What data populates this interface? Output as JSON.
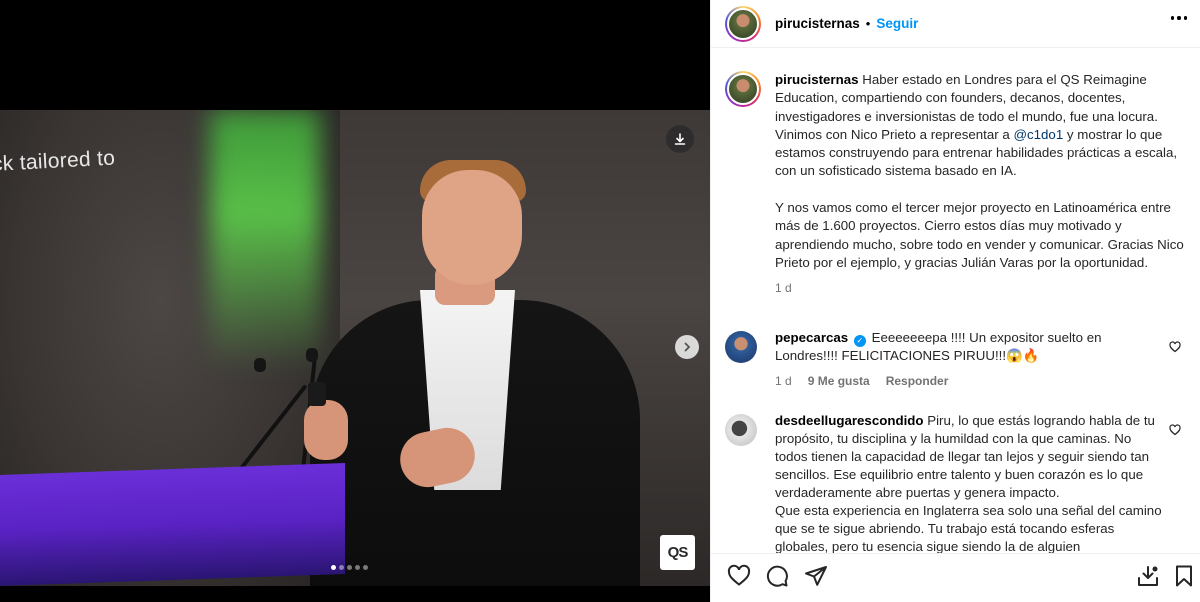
{
  "media": {
    "screen_text": "ack tailored to",
    "qs_logo": "QS",
    "carousel_count": 5,
    "carousel_active": 0,
    "icons": {
      "download": "download-icon",
      "next": "chevron-right-icon"
    }
  },
  "header": {
    "username": "pirucisternas",
    "separator": "•",
    "follow_label": "Seguir",
    "more": "more-icon"
  },
  "caption": {
    "username": "pirucisternas",
    "text_part1": "Haber estado en Londres para el QS Reimagine Education, compartiendo con founders, decanos, docentes, investigadores e inversionistas de todo el mundo, fue una locura. Vinimos con Nico Prieto a representar a ",
    "mention": "@c1do1",
    "text_part2": " y mostrar lo que estamos construyendo para entrenar habilidades prácticas a escala, con un sofisticado sistema basado en IA.",
    "text_para2": "Y nos vamos como el tercer mejor proyecto en Latinoamérica entre más de 1.600 proyectos. Cierro estos días muy motivado y aprendiendo mucho, sobre todo en vender y comunicar. Gracias Nico Prieto por el ejemplo, y gracias Julián Varas por la oportunidad.",
    "time": "1 d"
  },
  "comments": [
    {
      "username": "pepecarcas",
      "verified": true,
      "text": "Eeeeeeeepa !!!! Un expositor suelto en Londres!!!! FELICITACIONES PIRUU!!!😱🔥",
      "time": "1 d",
      "likes": "9 Me gusta",
      "reply": "Responder"
    },
    {
      "username": "desdeellugarescondido",
      "verified": false,
      "text": "Piru, lo que estás logrando habla de tu propósito, tu disciplina y la humildad con la que caminas. No todos tienen la capacidad de llegar tan lejos y seguir siendo tan sencillos. Ese equilibrio entre talento y buen corazón es lo que verdaderamente abre puertas y genera impacto.",
      "text2": "Que esta experiencia en Inglaterra sea solo una señal del camino que se te sigue abriendo. Tu trabajo está tocando esferas globales, pero tu esencia sigue siendo la de alguien"
    }
  ],
  "actions": {
    "like": "heart-icon",
    "comment": "comment-icon",
    "share": "share-icon",
    "tag": "tag-download-icon",
    "save": "bookmark-icon"
  },
  "colors": {
    "link": "#0095f6",
    "mention": "#00376b",
    "muted": "#737373",
    "podium": "#6b2fd8"
  }
}
